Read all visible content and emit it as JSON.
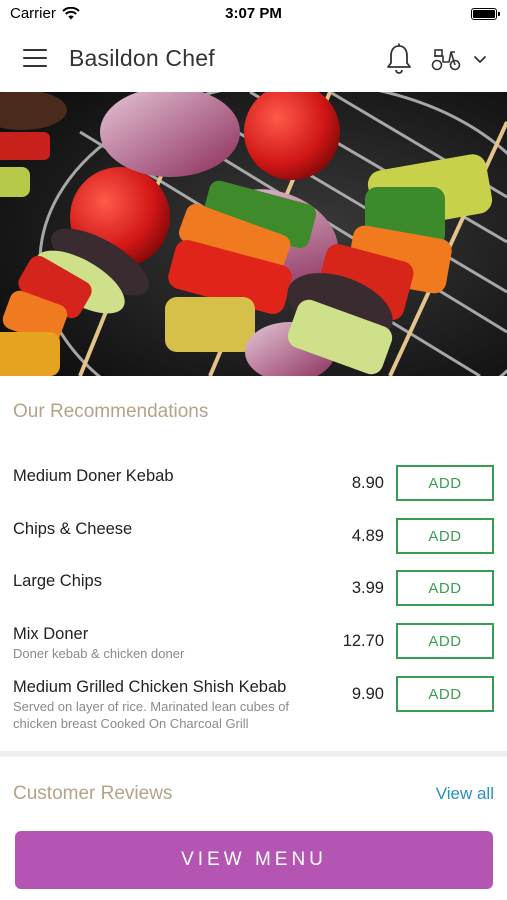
{
  "status_bar": {
    "carrier": "Carrier",
    "time": "3:07 PM"
  },
  "header": {
    "title": "Basildon Chef",
    "icons": [
      "menu-icon",
      "bell-icon",
      "scooter-icon",
      "chevron-down-icon"
    ]
  },
  "hero": {
    "image_description_icon": "kebab-skewers-image"
  },
  "recommendations": {
    "title": "Our Recommendations",
    "add_label": "ADD",
    "items": [
      {
        "name": "Medium Doner Kebab",
        "desc": "",
        "price": "8.90"
      },
      {
        "name": "Chips & Cheese",
        "desc": "",
        "price": "4.89"
      },
      {
        "name": "Large Chips",
        "desc": "",
        "price": "3.99"
      },
      {
        "name": "Mix Doner",
        "desc": "Doner kebab & chicken doner",
        "price": "12.70"
      },
      {
        "name": "Medium Grilled Chicken Shish Kebab",
        "desc": "Served on layer of rice.  Marinated lean cubes of chicken breast Cooked On Charcoal Grill",
        "price": "9.90"
      }
    ]
  },
  "reviews": {
    "title": "Customer Reviews",
    "view_all": "View all"
  },
  "footer": {
    "view_menu": "VIEW MENU"
  },
  "colors": {
    "accent": "#b455b3",
    "add_green": "#3a9e52",
    "section_title": "#b3a389",
    "link": "#2a8fc1"
  }
}
